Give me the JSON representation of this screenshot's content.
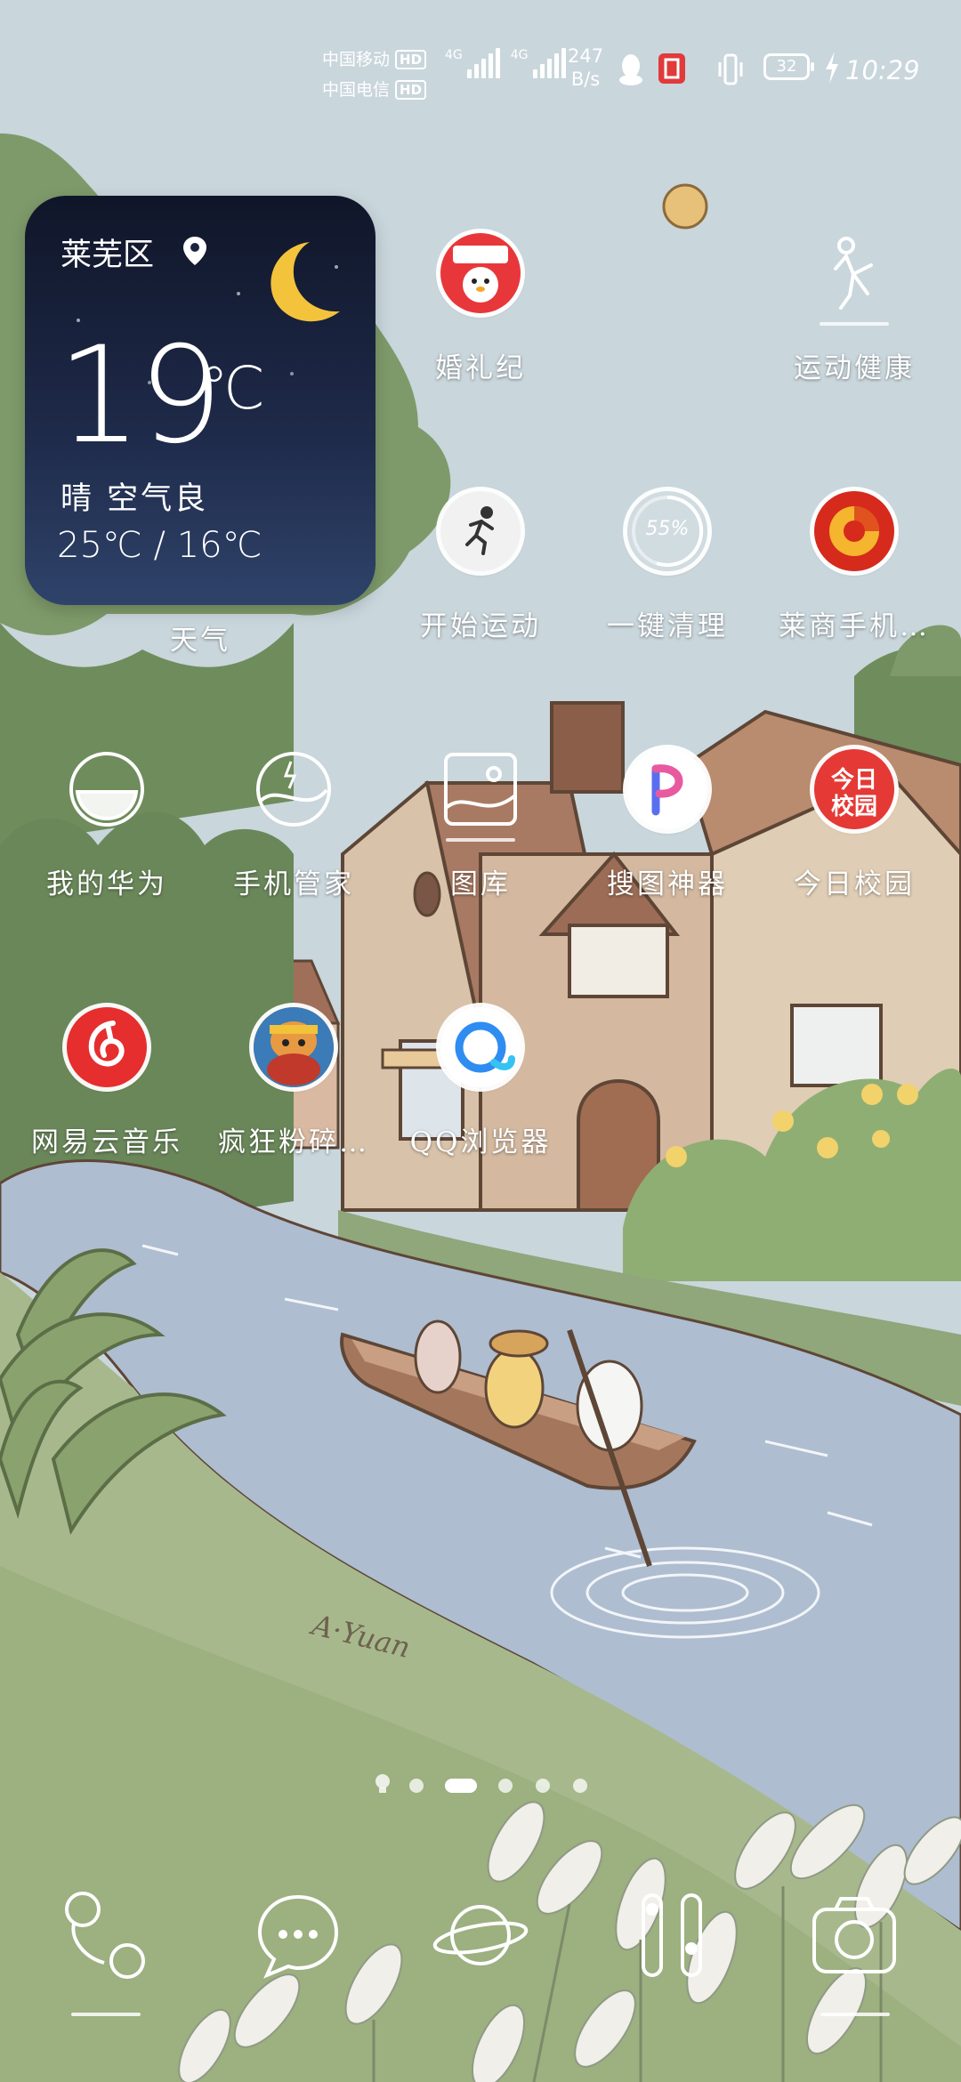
{
  "status_bar": {
    "carrier_1": "中国移动",
    "carrier_2": "中国电信",
    "hd_1": "HD",
    "hd_2": "HD",
    "network_1": "4G",
    "network_2": "4G",
    "net_speed_value": "247",
    "net_speed_unit": "B/s",
    "battery": "32",
    "time": "10:29",
    "icons": [
      "qq-icon",
      "book-icon",
      "vibrate-icon",
      "charging-bolt-icon"
    ]
  },
  "weather": {
    "location": "莱芜区",
    "temperature": "19",
    "unit": "℃",
    "condition": "晴 空气良",
    "range": "25℃ / 16℃",
    "label": "天气"
  },
  "apps": [
    {
      "label": "婚礼纪",
      "icon": "wedding-app-icon",
      "color": "#e8373a"
    },
    {
      "label": "运动健康",
      "icon": "runner-outline-icon",
      "color": "#ffffff"
    },
    {
      "label": "开始运动",
      "icon": "running-person-icon",
      "color": "#ffffff"
    },
    {
      "label": "一键清理",
      "icon": "cleanup-percent-icon",
      "badge": "55%",
      "color": "#ffffff"
    },
    {
      "label": "莱商手机…",
      "icon": "laishang-bank-icon",
      "color": "#d62a1c"
    },
    {
      "label": "我的华为",
      "icon": "bowl-outline-icon",
      "color": "#ffffff"
    },
    {
      "label": "手机管家",
      "icon": "shield-wave-icon",
      "color": "#ffffff"
    },
    {
      "label": "图库",
      "icon": "gallery-icon",
      "color": "#ffffff"
    },
    {
      "label": "搜图神器",
      "icon": "p-logo-icon",
      "color": "#ffffff"
    },
    {
      "label": "今日校园",
      "icon": "today-campus-icon",
      "badge_lines": [
        "今日",
        "校园"
      ],
      "color": "#e53935"
    },
    {
      "label": "网易云音乐",
      "icon": "netease-music-icon",
      "color": "#e62e2e"
    },
    {
      "label": "疯狂粉碎…",
      "icon": "game-character-icon",
      "color": "#c65a2b"
    },
    {
      "label": "QQ浏览器",
      "icon": "qq-browser-icon",
      "color": "#2f8cf0"
    }
  ],
  "page_indicator": {
    "pages": 5,
    "active_index": 2
  },
  "dock": [
    {
      "icon": "phone-icon"
    },
    {
      "icon": "messages-icon"
    },
    {
      "icon": "browser-planet-icon"
    },
    {
      "icon": "camera-flash-icon"
    },
    {
      "icon": "camera-icon"
    }
  ],
  "wallpaper": {
    "signature": "A·Yuan"
  }
}
